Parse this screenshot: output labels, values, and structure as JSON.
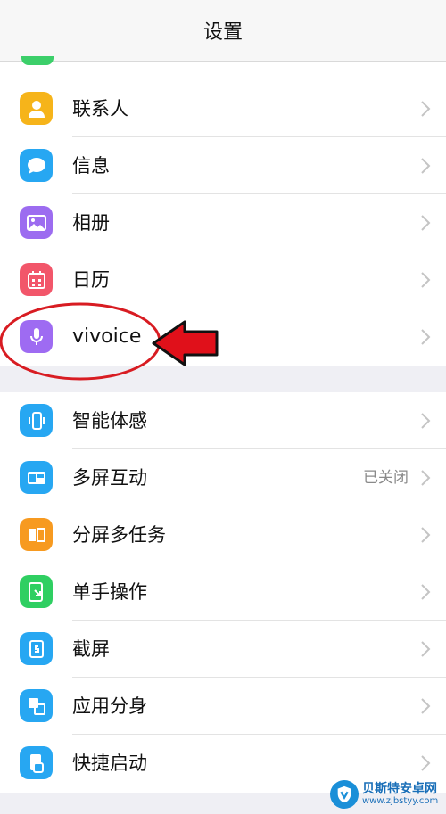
{
  "header": {
    "title": "设置"
  },
  "group1": [
    {
      "name": "contacts",
      "label": "联系人",
      "icon": "contacts-icon",
      "color": "#f6b41a"
    },
    {
      "name": "messages",
      "label": "信息",
      "icon": "message-icon",
      "color": "#27a7f2"
    },
    {
      "name": "album",
      "label": "相册",
      "icon": "photo-icon",
      "color": "#9c6cf0"
    },
    {
      "name": "calendar",
      "label": "日历",
      "icon": "calendar-icon",
      "color": "#f2566a"
    },
    {
      "name": "vivoice",
      "label": "vivoice",
      "icon": "microphone-icon",
      "color": "#9e6bf2"
    }
  ],
  "group2": [
    {
      "name": "smart-motion",
      "label": "智能体感",
      "icon": "phone-motion-icon",
      "color": "#27a7f2"
    },
    {
      "name": "multi-screen",
      "label": "多屏互动",
      "value": "已关闭",
      "icon": "screen-cast-icon",
      "color": "#27a7f2"
    },
    {
      "name": "split-screen",
      "label": "分屏多任务",
      "icon": "split-screen-icon",
      "color": "#f79a20"
    },
    {
      "name": "one-hand",
      "label": "单手操作",
      "icon": "one-hand-icon",
      "color": "#2fcf62"
    },
    {
      "name": "screenshot",
      "label": "截屏",
      "icon": "screenshot-icon",
      "color": "#27a7f2"
    },
    {
      "name": "app-clone",
      "label": "应用分身",
      "icon": "app-clone-icon",
      "color": "#27a7f2"
    },
    {
      "name": "quick-launch",
      "label": "快捷启动",
      "icon": "quick-launch-icon",
      "color": "#27a7f2"
    }
  ],
  "annotation": {
    "highlight_color": "#d81c22",
    "arrow_color": "#e0101a"
  },
  "watermark": {
    "line1": "贝斯特安卓网",
    "line2": "www.zjbstyy.com",
    "icon": "shield-v-icon"
  }
}
